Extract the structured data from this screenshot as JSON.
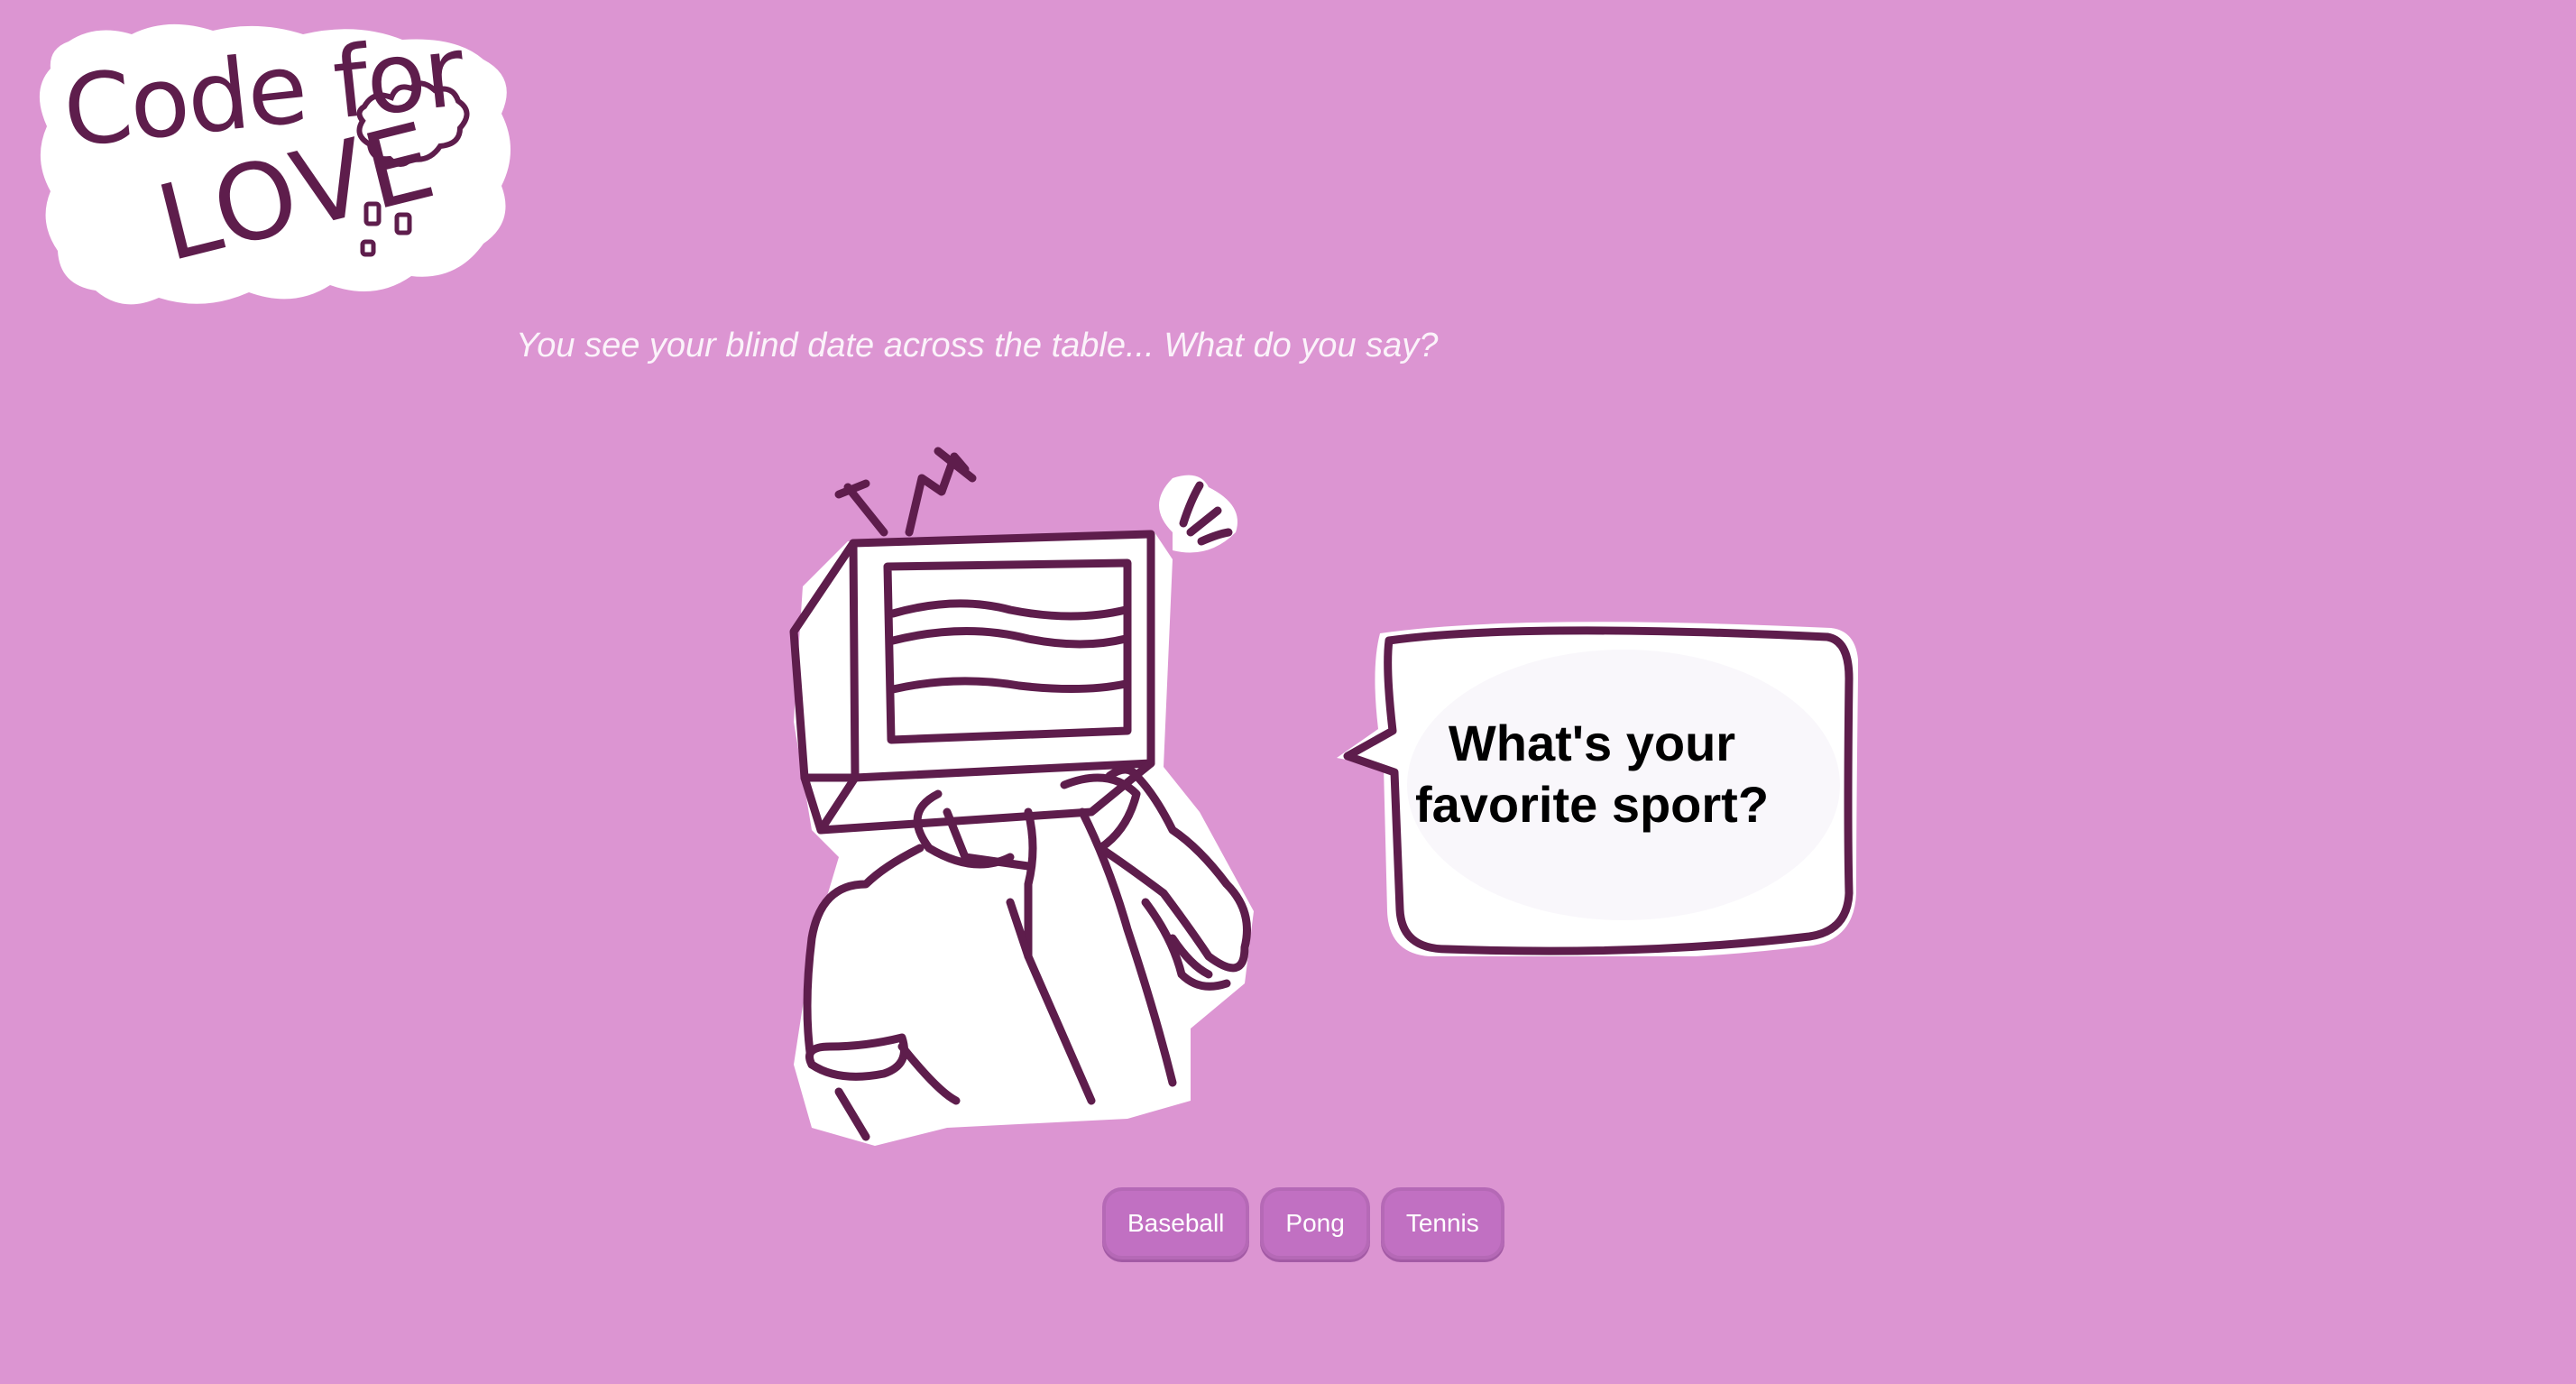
{
  "logo": {
    "line1": "Code for",
    "line2": "LOVE"
  },
  "prompt": "You see your blind date across the table... What do you say?",
  "speech_bubble": {
    "question": "What's your favorite sport?"
  },
  "options": [
    {
      "label": "Baseball"
    },
    {
      "label": "Pong"
    },
    {
      "label": "Tennis"
    }
  ],
  "colors": {
    "background": "#dc95d2",
    "ink": "#5e1d4c",
    "button": "#c170c2",
    "paper": "#ffffff"
  },
  "icons": [
    "heart-icon",
    "tv-head-character",
    "sparkle-icon"
  ]
}
